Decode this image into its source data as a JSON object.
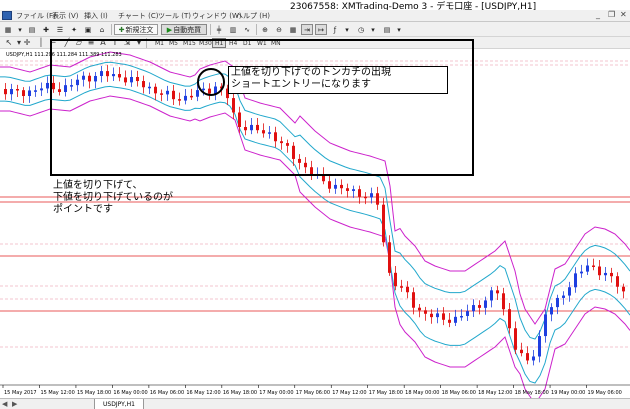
{
  "window": {
    "title": "23067558: XMTrading-Demo 3 - デモ口座 - [USDJPY,H1]"
  },
  "menu": {
    "items": [
      "ファイル (F)",
      "表示 (V)",
      "挿入 (I)",
      "チャート (C)",
      "ツール (T)",
      "ウィンドウ (W)",
      "ヘルプ (H)"
    ]
  },
  "toolbar": {
    "new_order_label": "新規注文",
    "auto_trade_label": "自動売買"
  },
  "timeframes": [
    "M1",
    "M5",
    "M15",
    "M30",
    "H1",
    "H4",
    "D1",
    "W1",
    "MN"
  ],
  "active_timeframe": "H1",
  "chart": {
    "symbol_info": "USDJPY,H1  111.296 111.284 111.389 111.283",
    "x_labels": [
      "15 May 2017",
      "15 May 12:00",
      "15 May 18:00",
      "16 May 00:00",
      "16 May 06:00",
      "16 May 12:00",
      "16 May 18:00",
      "17 May 00:00",
      "17 May 06:00",
      "17 May 12:00",
      "17 May 18:00",
      "18 May 00:00",
      "18 May 06:00",
      "18 May 12:00",
      "18 May 18:00",
      "19 May 00:00",
      "19 May 06:00"
    ]
  },
  "annotations": {
    "top_line1": "上値を切り下げでのトンカチの出現",
    "top_line2": "ショートエントリーになります",
    "left_line1": "上値を切り下げて、",
    "left_line2": "下値を切り下げているのが",
    "left_line3": "ポイントです"
  },
  "tabs": {
    "active": "USDJPY,H1"
  },
  "colors": {
    "bull": "#1f3fe0",
    "bear": "#e01010",
    "bb_outer": "#cc22cc",
    "bb_inner": "#22a8cc",
    "hline_red": "#e02020",
    "hline_pink": "#e88aa0"
  }
}
